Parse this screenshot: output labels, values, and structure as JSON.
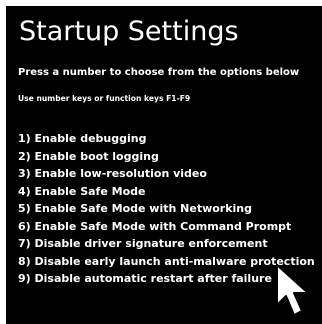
{
  "title": "Startup Settings",
  "subtitle": "Press a number to choose from the options below",
  "hint": "Use number keys or function keys F1-F9",
  "options": [
    {
      "label": "1) Enable debugging"
    },
    {
      "label": "2) Enable boot logging"
    },
    {
      "label": "3) Enable low-resolution video"
    },
    {
      "label": "4) Enable Safe Mode"
    },
    {
      "label": "5) Enable Safe Mode with Networking"
    },
    {
      "label": "6) Enable Safe Mode with Command Prompt"
    },
    {
      "label": "7) Disable driver signature enforcement"
    },
    {
      "label": "8) Disable early launch anti-malware protection"
    },
    {
      "label": "9) Disable automatic restart after failure"
    }
  ],
  "colors": {
    "background": "#000000",
    "text": "#ffffff",
    "cursor_fill": "#ffffff",
    "cursor_outline": "#000000"
  },
  "icons": {
    "cursor": "mouse-pointer-icon"
  }
}
